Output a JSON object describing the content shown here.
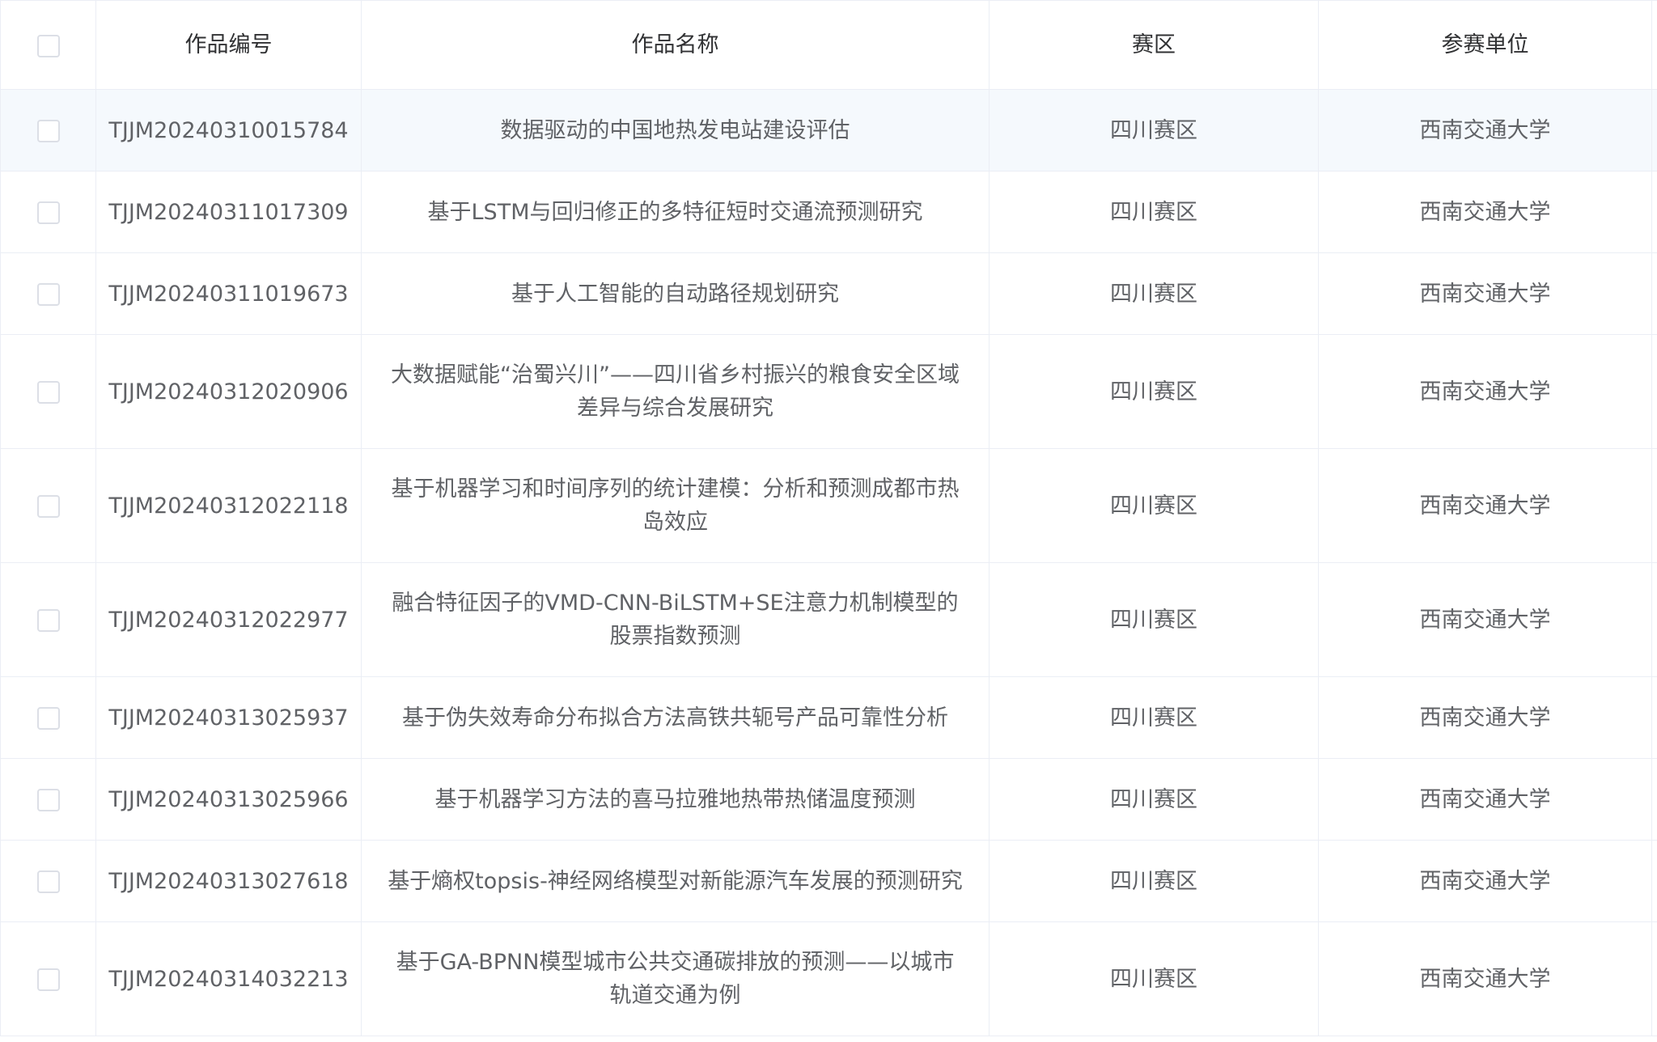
{
  "table": {
    "headers": {
      "id": "作品编号",
      "name": "作品名称",
      "region": "赛区",
      "unit": "参赛单位"
    },
    "rows": [
      {
        "id": "TJJM20240310015784",
        "name": "数据驱动的中国地热发电站建设评估",
        "region": "四川赛区",
        "unit": "西南交通大学"
      },
      {
        "id": "TJJM20240311017309",
        "name": "基于LSTM与回归修正的多特征短时交通流预测研究",
        "region": "四川赛区",
        "unit": "西南交通大学"
      },
      {
        "id": "TJJM20240311019673",
        "name": "基于人工智能的自动路径规划研究",
        "region": "四川赛区",
        "unit": "西南交通大学"
      },
      {
        "id": "TJJM20240312020906",
        "name": "大数据赋能“治蜀兴川”——四川省乡村振兴的粮食安全区域差异与综合发展研究",
        "region": "四川赛区",
        "unit": "西南交通大学"
      },
      {
        "id": "TJJM20240312022118",
        "name": "基于机器学习和时间序列的统计建模：分析和预测成都市热岛效应",
        "region": "四川赛区",
        "unit": "西南交通大学"
      },
      {
        "id": "TJJM20240312022977",
        "name": "融合特征因子的VMD-CNN-BiLSTM+SE注意力机制模型的股票指数预测",
        "region": "四川赛区",
        "unit": "西南交通大学"
      },
      {
        "id": "TJJM20240313025937",
        "name": "基于伪失效寿命分布拟合方法高铁共轭号产品可靠性分析",
        "region": "四川赛区",
        "unit": "西南交通大学"
      },
      {
        "id": "TJJM20240313025966",
        "name": "基于机器学习方法的喜马拉雅地热带热储温度预测",
        "region": "四川赛区",
        "unit": "西南交通大学"
      },
      {
        "id": "TJJM20240313027618",
        "name": "基于熵权topsis-神经网络模型对新能源汽车发展的预测研究",
        "region": "四川赛区",
        "unit": "西南交通大学"
      },
      {
        "id": "TJJM20240314032213",
        "name": "基于GA-BPNN模型城市公共交通碳排放的预测——以城市轨道交通为例",
        "region": "四川赛区",
        "unit": "西南交通大学"
      }
    ]
  },
  "colors": {
    "border": "#ebeef5",
    "header_text": "#303133",
    "cell_text": "#606266",
    "highlight_row": "#f5f9fd",
    "checkbox_border": "#dcdfe6"
  }
}
